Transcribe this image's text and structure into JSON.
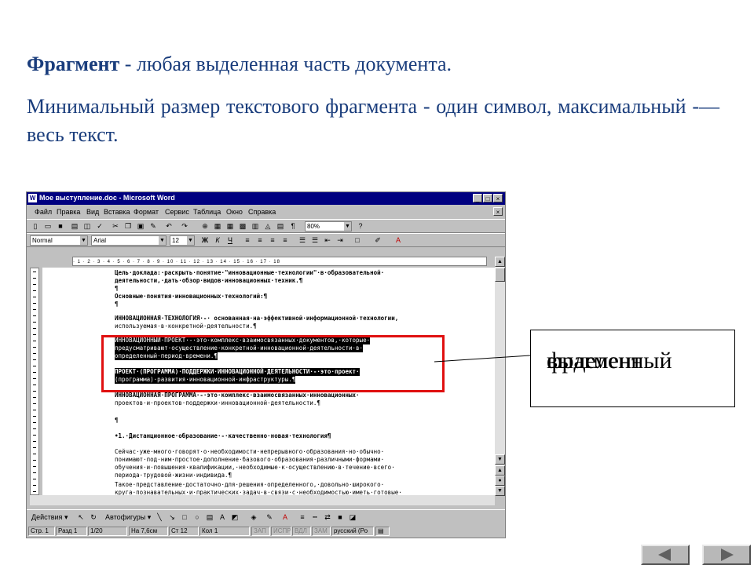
{
  "slide": {
    "term": "Фрагмент",
    "definition_rest": " - любая выделенная часть документа.",
    "paragraph2": "Минимальный размер текстового фрагмента -  один символ, максимальный -— весь текст."
  },
  "word": {
    "title": "Мое выступление.doc - Microsoft Word",
    "menu": [
      "Файл",
      "Правка",
      "Вид",
      "Вставка",
      "Формат",
      "Сервис",
      "Таблица",
      "Окно",
      "Справка"
    ],
    "zoom": "80%",
    "style": "Normal",
    "font": "Arial",
    "size": "12",
    "ruler": "· 1 · 2 · 3 · 4 · 5 · 6 · 7 · 8 · 9 · 10 · 11 · 12 · 13 · 14 · 15 · 16 · 17 · 18",
    "doc_lines": [
      "Цель·доклада:·раскрыть·понятие·\"инновационные·технологии\"·в·образовательной·",
      "деятельности,·дать·обзор·видов·инновационных·техник.¶",
      "¶",
      "Основные·понятия·инновационных·технологий:¶",
      "¶",
      "ИННОВАЦИОННАЯ·ТЕХНОЛОГИЯ·-·   основанная·на·эффективной·информационной·технологии,",
      "используемая·в·конкретной·деятельности.¶",
      "ИННОВАЦИОННЫЙ·ПРОЕКТ·-·это·комплекс·взаимосвязанных·документов,·которые·",
      "предусматривают·осуществление·конкретной·инновационной·деятельности·в·",
      "определенный·период·времени.¶",
      "ПРОЕКТ·(ПРОГРАММА)·ПОДДЕРЖКИ·ИННОВАЦИОННОЙ·ДЕЯТЕЛЬНОСТИ·-·это·проект·",
      "(программа)·развития·инновационной·инфраструктуры.¶",
      "ИННОВАЦИОННАЯ·ПРОГРАММА·-·это·комплекс·взаимосвязанных·инновационных·",
      "проектов·и·проектов·поддержки·инновационной·деятельности.¶",
      "¶",
      "•1.·Дистанционное·образование·-·качественно·новая·технология¶",
      "     Сейчас·уже·много·говорят·о·необходимости·непрерывного·образования·но·обычно·",
      "понимают·под·ним·простое·дополнение·базового·образования·различными·формами·",
      "обучения·и·повышения·квалификации,·необходимые·к·осуществлению·в·течение·всего·",
      "периода·трудовой·жизни·индивида.¶",
      "     Такое·представление·достаточно·для·решения·определенного,·довольно·широкого·",
      "круга·познавательных·и·практических·задач·в·связи·с·необходимостью·иметь·готовые·"
    ],
    "draw_toolbar": {
      "actions": "Действия",
      "autoshapes": "Автофигуры"
    },
    "status": {
      "page": "Стр. 1",
      "section": "Разд 1",
      "pages": "1/20",
      "at": "На 7,6см",
      "line": "Ст 12",
      "col": "Кол 1",
      "rec": "ЗАП",
      "trk": "ИСПР",
      "ext": "ВДЛ",
      "ovr": "ЗАМ",
      "lang": "русский (Ро"
    }
  },
  "callout": {
    "line1": "выделенный",
    "line2": "фрагмент"
  },
  "nav": {
    "prev": "◀",
    "next": "▶"
  }
}
